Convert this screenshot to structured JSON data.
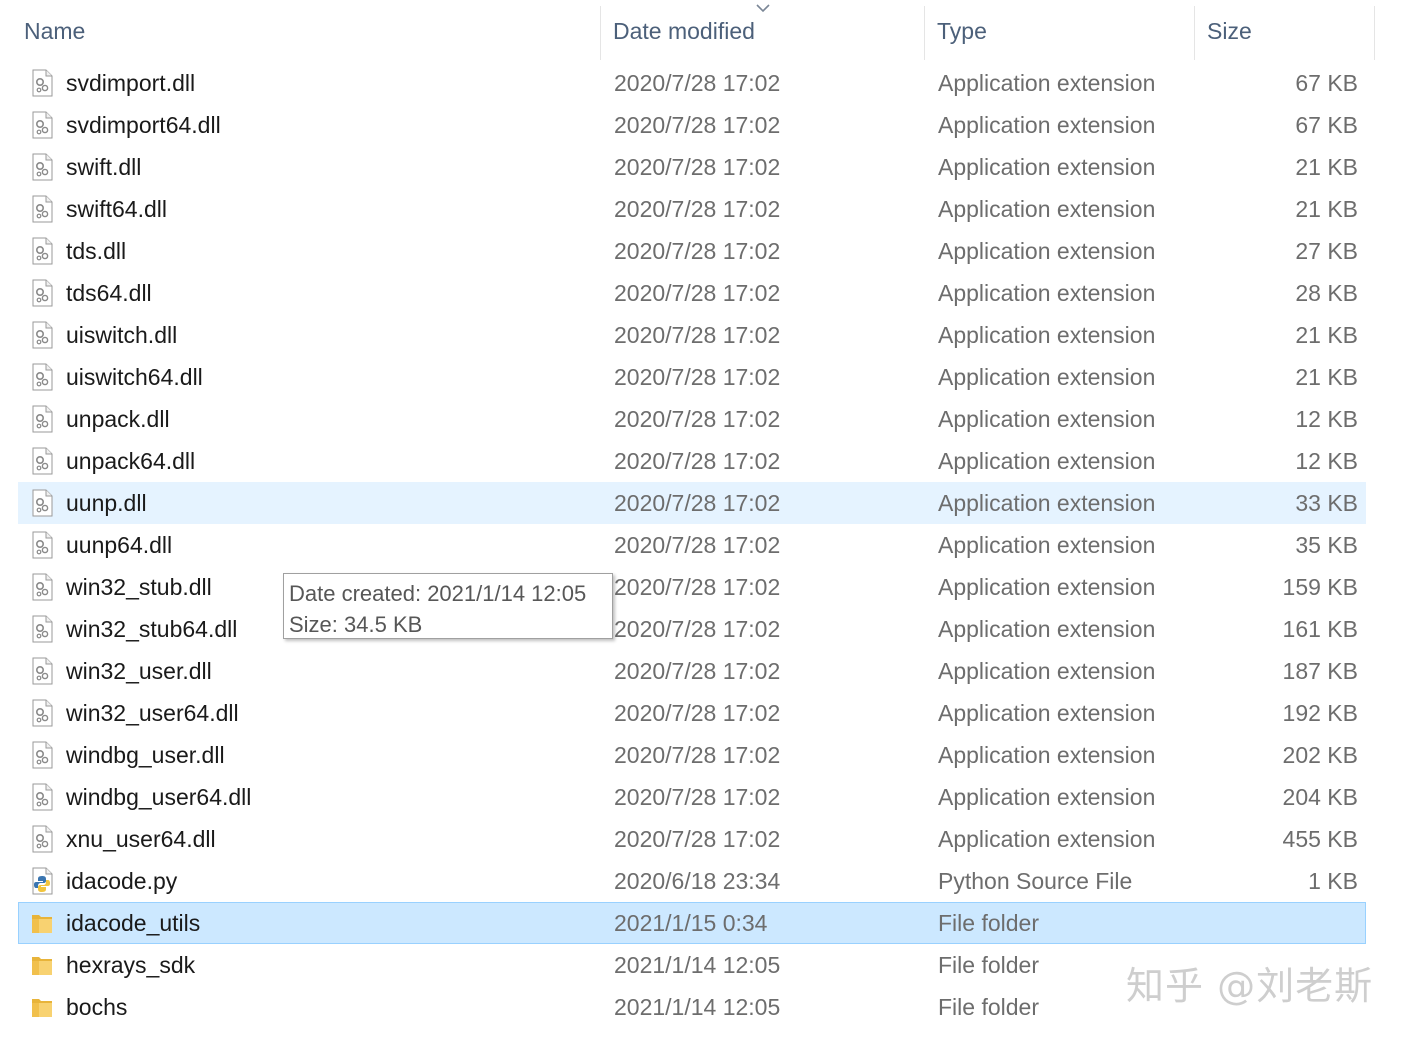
{
  "columns": {
    "name": "Name",
    "date": "Date modified",
    "type": "Type",
    "size": "Size"
  },
  "files": [
    {
      "name": "svdimport.dll",
      "date": "2020/7/28 17:02",
      "type": "Application extension",
      "size": "67 KB",
      "icon": "dll-file-icon",
      "state": ""
    },
    {
      "name": "svdimport64.dll",
      "date": "2020/7/28 17:02",
      "type": "Application extension",
      "size": "67 KB",
      "icon": "dll-file-icon",
      "state": ""
    },
    {
      "name": "swift.dll",
      "date": "2020/7/28 17:02",
      "type": "Application extension",
      "size": "21 KB",
      "icon": "dll-file-icon",
      "state": ""
    },
    {
      "name": "swift64.dll",
      "date": "2020/7/28 17:02",
      "type": "Application extension",
      "size": "21 KB",
      "icon": "dll-file-icon",
      "state": ""
    },
    {
      "name": "tds.dll",
      "date": "2020/7/28 17:02",
      "type": "Application extension",
      "size": "27 KB",
      "icon": "dll-file-icon",
      "state": ""
    },
    {
      "name": "tds64.dll",
      "date": "2020/7/28 17:02",
      "type": "Application extension",
      "size": "28 KB",
      "icon": "dll-file-icon",
      "state": ""
    },
    {
      "name": "uiswitch.dll",
      "date": "2020/7/28 17:02",
      "type": "Application extension",
      "size": "21 KB",
      "icon": "dll-file-icon",
      "state": ""
    },
    {
      "name": "uiswitch64.dll",
      "date": "2020/7/28 17:02",
      "type": "Application extension",
      "size": "21 KB",
      "icon": "dll-file-icon",
      "state": ""
    },
    {
      "name": "unpack.dll",
      "date": "2020/7/28 17:02",
      "type": "Application extension",
      "size": "12 KB",
      "icon": "dll-file-icon",
      "state": ""
    },
    {
      "name": "unpack64.dll",
      "date": "2020/7/28 17:02",
      "type": "Application extension",
      "size": "12 KB",
      "icon": "dll-file-icon",
      "state": ""
    },
    {
      "name": "uunp.dll",
      "date": "2020/7/28 17:02",
      "type": "Application extension",
      "size": "33 KB",
      "icon": "dll-file-icon",
      "state": "hover"
    },
    {
      "name": "uunp64.dll",
      "date": "2020/7/28 17:02",
      "type": "Application extension",
      "size": "35 KB",
      "icon": "dll-file-icon",
      "state": ""
    },
    {
      "name": "win32_stub.dll",
      "date": "2020/7/28 17:02",
      "type": "Application extension",
      "size": "159 KB",
      "icon": "dll-file-icon",
      "state": ""
    },
    {
      "name": "win32_stub64.dll",
      "date": "2020/7/28 17:02",
      "type": "Application extension",
      "size": "161 KB",
      "icon": "dll-file-icon",
      "state": ""
    },
    {
      "name": "win32_user.dll",
      "date": "2020/7/28 17:02",
      "type": "Application extension",
      "size": "187 KB",
      "icon": "dll-file-icon",
      "state": ""
    },
    {
      "name": "win32_user64.dll",
      "date": "2020/7/28 17:02",
      "type": "Application extension",
      "size": "192 KB",
      "icon": "dll-file-icon",
      "state": ""
    },
    {
      "name": "windbg_user.dll",
      "date": "2020/7/28 17:02",
      "type": "Application extension",
      "size": "202 KB",
      "icon": "dll-file-icon",
      "state": ""
    },
    {
      "name": "windbg_user64.dll",
      "date": "2020/7/28 17:02",
      "type": "Application extension",
      "size": "204 KB",
      "icon": "dll-file-icon",
      "state": ""
    },
    {
      "name": "xnu_user64.dll",
      "date": "2020/7/28 17:02",
      "type": "Application extension",
      "size": "455 KB",
      "icon": "dll-file-icon",
      "state": ""
    },
    {
      "name": "idacode.py",
      "date": "2020/6/18 23:34",
      "type": "Python Source File",
      "size": "1 KB",
      "icon": "python-file-icon",
      "state": ""
    },
    {
      "name": "idacode_utils",
      "date": "2021/1/15 0:34",
      "type": "File folder",
      "size": "",
      "icon": "folder-icon",
      "state": "selected"
    },
    {
      "name": "hexrays_sdk",
      "date": "2021/1/14 12:05",
      "type": "File folder",
      "size": "",
      "icon": "folder-icon",
      "state": ""
    },
    {
      "name": "bochs",
      "date": "2021/1/14 12:05",
      "type": "File folder",
      "size": "",
      "icon": "folder-icon",
      "state": ""
    }
  ],
  "tooltip": {
    "line1": "Date created: 2021/1/14 12:05",
    "line2": "Size: 34.5 KB"
  },
  "watermark": "知乎 @刘老斯",
  "colors": {
    "header_text": "#4c607a",
    "hover": "#e5f3ff",
    "selected": "#cce8ff",
    "selected_border": "#99d1ff"
  }
}
